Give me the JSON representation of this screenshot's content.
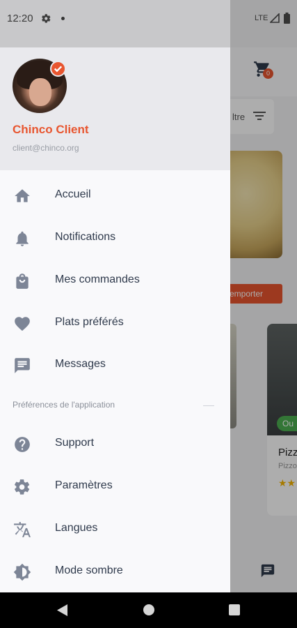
{
  "status_bar": {
    "time": "12:20",
    "network": "LTE"
  },
  "drawer": {
    "user": {
      "name": "Chinco Client",
      "email": "client@chinco.org"
    },
    "menu": [
      {
        "label": "Accueil",
        "icon": "home-icon"
      },
      {
        "label": "Notifications",
        "icon": "bell-icon"
      },
      {
        "label": "Mes commandes",
        "icon": "shopping-bag-icon"
      },
      {
        "label": "Plats préférés",
        "icon": "heart-icon"
      },
      {
        "label": "Messages",
        "icon": "chat-icon"
      }
    ],
    "section_title": "Préférences de l'application",
    "settings": [
      {
        "label": "Support",
        "icon": "help-icon"
      },
      {
        "label": "Paramètres",
        "icon": "gear-icon"
      },
      {
        "label": "Langues",
        "icon": "translate-icon"
      },
      {
        "label": "Mode sombre",
        "icon": "brightness-icon"
      }
    ]
  },
  "background": {
    "cart_count": "0",
    "filter_label": "ltre",
    "takeaway_label": "emporter",
    "open_badge": "Ou",
    "card_title": "Pizz",
    "card_subtitle": "Pizzo"
  },
  "colors": {
    "accent": "#e8552f",
    "text": "#2f3a4c",
    "muted": "#9a9ea6",
    "icon": "#7d8596"
  }
}
